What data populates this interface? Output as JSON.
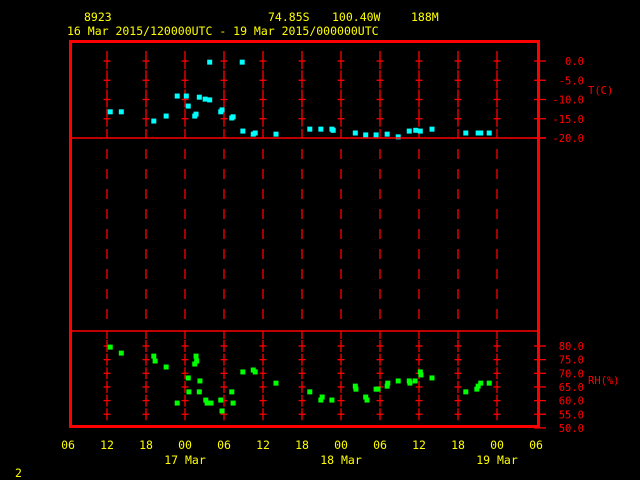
{
  "header": {
    "station": "8923",
    "lat": "74.85S",
    "lon": "100.40W",
    "elev": "188M",
    "time_range": "16 Mar 2015/120000UTC - 19 Mar 2015/000000UTC"
  },
  "footer": {
    "frame_number": "2"
  },
  "colors": {
    "axis": "#ff0000",
    "text": "#ffff00",
    "temperature": "#00ffff",
    "rh": "#00ff00"
  },
  "chart_data": [
    {
      "type": "scatter",
      "title": "Temperature",
      "ylabel": "T(C)",
      "ylim": [
        -20,
        0
      ],
      "yticks": [
        0,
        -5,
        -10,
        -15,
        -20
      ],
      "ytick_labels": [
        "0.0",
        "-5.0",
        "-10.0",
        "-15.0",
        "-20.0"
      ],
      "x_units": "hours since 16 Mar 06UTC",
      "xlim": [
        0,
        72
      ],
      "xtick_labels": [
        "06",
        "12",
        "18",
        "00",
        "06",
        "12",
        "18",
        "00",
        "06",
        "12",
        "18",
        "00",
        "06"
      ],
      "date_labels": [
        {
          "hour": 18,
          "label": "17 Mar"
        },
        {
          "hour": 42,
          "label": "18 Mar"
        },
        {
          "hour": 66,
          "label": "19 Mar"
        }
      ],
      "series": [
        {
          "name": "T",
          "points": [
            [
              6.5,
              -13.2
            ],
            [
              8.2,
              -13.2
            ],
            [
              13.2,
              -15.6
            ],
            [
              15.1,
              -14.3
            ],
            [
              16.8,
              -9.1
            ],
            [
              18.2,
              -9.1
            ],
            [
              18.5,
              -11.7
            ],
            [
              19.5,
              -14.3
            ],
            [
              19.7,
              -13.8
            ],
            [
              20.2,
              -9.4
            ],
            [
              21.1,
              -9.9
            ],
            [
              21.8,
              -10.1
            ],
            [
              21.8,
              -0.3
            ],
            [
              23.5,
              -13.2
            ],
            [
              23.7,
              -12.7
            ],
            [
              25.2,
              -14.8
            ],
            [
              25.4,
              -14.5
            ],
            [
              26.8,
              -0.3
            ],
            [
              26.9,
              -18.2
            ],
            [
              28.5,
              -19.0
            ],
            [
              28.8,
              -18.7
            ],
            [
              32.0,
              -19.0
            ],
            [
              37.2,
              -17.7
            ],
            [
              38.9,
              -17.7
            ],
            [
              40.6,
              -17.7
            ],
            [
              40.8,
              -18.0
            ],
            [
              44.2,
              -18.7
            ],
            [
              45.8,
              -19.2
            ],
            [
              47.4,
              -19.2
            ],
            [
              49.1,
              -19.0
            ],
            [
              50.8,
              -19.7
            ],
            [
              52.5,
              -18.2
            ],
            [
              53.5,
              -18.0
            ],
            [
              54.2,
              -18.2
            ],
            [
              56.0,
              -17.7
            ],
            [
              61.2,
              -18.7
            ],
            [
              63.1,
              -18.7
            ],
            [
              63.5,
              -18.7
            ],
            [
              64.8,
              -18.7
            ]
          ]
        }
      ]
    },
    {
      "type": "scatter",
      "title": "Relative Humidity",
      "ylabel": "RH(%)",
      "ylim": [
        50,
        80
      ],
      "yticks": [
        80,
        75,
        70,
        65,
        60,
        55,
        50
      ],
      "ytick_labels": [
        "80.0",
        "75.0",
        "70.0",
        "65.0",
        "60.0",
        "55.0",
        "50.0"
      ],
      "x_units": "hours since 16 Mar 06UTC",
      "xlim": [
        0,
        72
      ],
      "series": [
        {
          "name": "RH",
          "points": [
            [
              6.5,
              79.6
            ],
            [
              8.2,
              77.4
            ],
            [
              13.2,
              76.3
            ],
            [
              13.4,
              74.5
            ],
            [
              15.1,
              72.3
            ],
            [
              19.7,
              76.3
            ],
            [
              19.8,
              74.5
            ],
            [
              19.5,
              73.4
            ],
            [
              18.5,
              68.3
            ],
            [
              20.3,
              67.2
            ],
            [
              26.9,
              70.5
            ],
            [
              28.5,
              71.2
            ],
            [
              28.8,
              70.5
            ],
            [
              32.0,
              66.4
            ],
            [
              18.6,
              63.2
            ],
            [
              20.2,
              63.2
            ],
            [
              25.2,
              63.2
            ],
            [
              37.2,
              63.2
            ],
            [
              39.1,
              61.3
            ],
            [
              38.9,
              60.2
            ],
            [
              40.6,
              60.2
            ],
            [
              16.8,
              59.1
            ],
            [
              21.2,
              60.2
            ],
            [
              21.4,
              59.1
            ],
            [
              22.0,
              59.1
            ],
            [
              23.5,
              60.2
            ],
            [
              25.4,
              59.1
            ],
            [
              23.7,
              56.2
            ],
            [
              44.2,
              65.3
            ],
            [
              44.3,
              64.2
            ],
            [
              45.8,
              61.3
            ],
            [
              46.0,
              60.2
            ],
            [
              47.4,
              64.2
            ],
            [
              47.7,
              64.2
            ],
            [
              49.1,
              65.3
            ],
            [
              49.2,
              66.4
            ],
            [
              50.8,
              67.2
            ],
            [
              52.5,
              67.2
            ],
            [
              52.6,
              66.4
            ],
            [
              53.4,
              67.2
            ],
            [
              54.2,
              70.5
            ],
            [
              54.3,
              69.4
            ],
            [
              56.0,
              68.3
            ],
            [
              61.2,
              63.2
            ],
            [
              62.9,
              64.2
            ],
            [
              63.1,
              65.3
            ],
            [
              63.5,
              66.4
            ],
            [
              64.8,
              66.4
            ]
          ]
        }
      ]
    }
  ]
}
